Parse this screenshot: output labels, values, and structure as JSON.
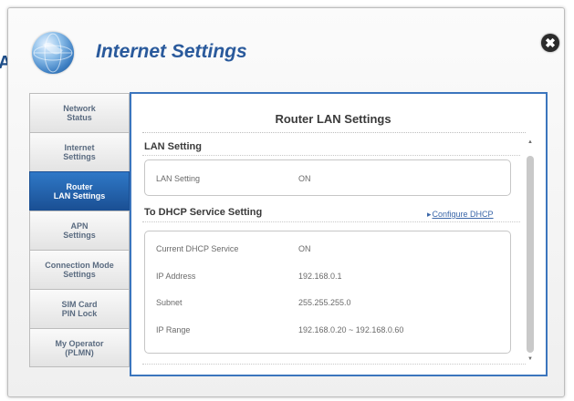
{
  "background_fragment": "AN",
  "header": {
    "title": "Internet Settings",
    "close_label": "✖"
  },
  "sidebar": {
    "items": [
      {
        "label": "Network\nStatus",
        "active": false
      },
      {
        "label": "Internet\nSettings",
        "active": false
      },
      {
        "label": "Router\nLAN Settings",
        "active": true
      },
      {
        "label": "APN\nSettings",
        "active": false
      },
      {
        "label": "Connection Mode\nSettings",
        "active": false
      },
      {
        "label": "SIM Card\nPIN Lock",
        "active": false
      },
      {
        "label": "My Operator\n(PLMN)",
        "active": false
      }
    ]
  },
  "main": {
    "title": "Router LAN Settings",
    "lan_section": {
      "heading": "LAN Setting",
      "rows": [
        {
          "label": "LAN Setting",
          "value": "ON"
        }
      ]
    },
    "dhcp_section": {
      "heading": "To DHCP Service Setting",
      "configure_link": "Configure DHCP",
      "rows": [
        {
          "label": "Current DHCP Service",
          "value": "ON"
        },
        {
          "label": "IP Address",
          "value": "192.168.0.1"
        },
        {
          "label": "Subnet",
          "value": "255.255.255.0"
        },
        {
          "label": "IP Range",
          "value": "192.168.0.20 ~ 192.168.0.60"
        }
      ]
    }
  },
  "colors": {
    "accent": "#2a5a9c",
    "active_nav": "#1f5ca5",
    "panel_border": "#3b75bd"
  }
}
